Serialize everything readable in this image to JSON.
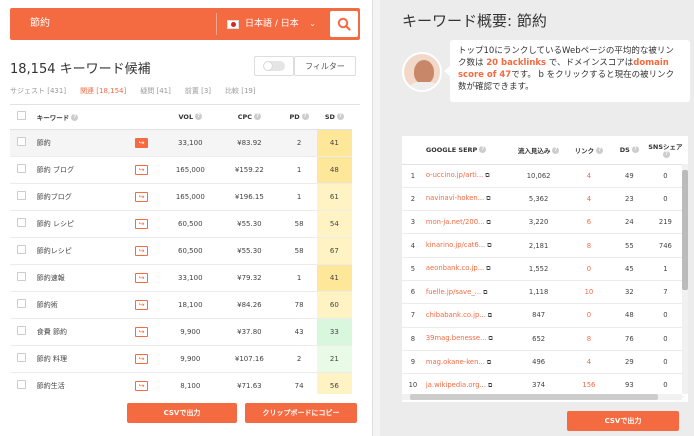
{
  "search": {
    "query": "節約",
    "language": "日本語 / 日本"
  },
  "left": {
    "count_title": "18,154 キーワード候補",
    "filter_label": "フィルター",
    "tabs": [
      {
        "label": "サジェスト [431]",
        "active": false
      },
      {
        "label": "関連 [18,154]",
        "active": true
      },
      {
        "label": "疑問 [41]",
        "active": false
      },
      {
        "label": "前置 [3]",
        "active": false
      },
      {
        "label": "比較 [19]",
        "active": false
      }
    ],
    "columns": {
      "keyword": "キーワード",
      "vol": "VOL",
      "cpc": "CPC",
      "pd": "PD",
      "sd": "SD"
    },
    "rows": [
      {
        "keyword": "節約",
        "vol": "33,100",
        "cpc": "¥83.92",
        "pd": "2",
        "sd": "41",
        "selected": true
      },
      {
        "keyword": "節約 ブログ",
        "vol": "165,000",
        "cpc": "¥159.22",
        "pd": "1",
        "sd": "48",
        "selected": false
      },
      {
        "keyword": "節約ブログ",
        "vol": "165,000",
        "cpc": "¥196.15",
        "pd": "1",
        "sd": "61",
        "selected": false
      },
      {
        "keyword": "節約 レシピ",
        "vol": "60,500",
        "cpc": "¥55.30",
        "pd": "58",
        "sd": "54",
        "selected": false
      },
      {
        "keyword": "節約レシピ",
        "vol": "60,500",
        "cpc": "¥55.30",
        "pd": "58",
        "sd": "67",
        "selected": false
      },
      {
        "keyword": "節約速報",
        "vol": "33,100",
        "cpc": "¥79.32",
        "pd": "1",
        "sd": "41",
        "selected": false
      },
      {
        "keyword": "節約術",
        "vol": "18,100",
        "cpc": "¥84.26",
        "pd": "78",
        "sd": "60",
        "selected": false
      },
      {
        "keyword": "食費 節約",
        "vol": "9,900",
        "cpc": "¥37.80",
        "pd": "43",
        "sd": "33",
        "selected": false
      },
      {
        "keyword": "節約 料理",
        "vol": "9,900",
        "cpc": "¥107.16",
        "pd": "2",
        "sd": "21",
        "selected": false
      },
      {
        "keyword": "節約生活",
        "vol": "8,100",
        "cpc": "¥71.63",
        "pd": "74",
        "sd": "56",
        "selected": false
      }
    ],
    "btn_csv": "CSVで出力",
    "btn_copy": "クリップボードにコピー"
  },
  "right": {
    "title": "キーワード概要: 節約",
    "bubble": {
      "p1": "トップ10にランクしているWebページの平均的な被リンク数は ",
      "backlinks": "20 backlinks",
      "p2": " で、ドメインスコアは",
      "domain_score": "domain score of 47",
      "p3": "です。 b をクリックすると現在の被リンク数が確認できます。"
    },
    "serp_columns": {
      "serp": "GOOGLE SERP",
      "inflow": "流入見込み",
      "links": "リンク",
      "ds": "DS",
      "sns": "SNSシェア"
    },
    "serp_rows": [
      {
        "no": "1",
        "url": "o-uccino.jp/arti...",
        "inflow": "10,062",
        "links": "4",
        "ds": "49",
        "sns": "0"
      },
      {
        "no": "2",
        "url": "navinavi-hoken...",
        "inflow": "5,362",
        "links": "4",
        "ds": "23",
        "sns": "0"
      },
      {
        "no": "3",
        "url": "mon-ja.net/200...",
        "inflow": "3,220",
        "links": "6",
        "ds": "24",
        "sns": "219"
      },
      {
        "no": "4",
        "url": "kinarino.jp/cat6...",
        "inflow": "2,181",
        "links": "8",
        "ds": "55",
        "sns": "746"
      },
      {
        "no": "5",
        "url": "aeonbank.co.jp...",
        "inflow": "1,552",
        "links": "0",
        "ds": "45",
        "sns": "1"
      },
      {
        "no": "6",
        "url": "fuelle.jp/save_...",
        "inflow": "1,118",
        "links": "10",
        "ds": "32",
        "sns": "7"
      },
      {
        "no": "7",
        "url": "chibabank.co.jp...",
        "inflow": "847",
        "links": "0",
        "ds": "48",
        "sns": "0"
      },
      {
        "no": "8",
        "url": "39mag.benesse...",
        "inflow": "652",
        "links": "8",
        "ds": "76",
        "sns": "0"
      },
      {
        "no": "9",
        "url": "mag.okane-ken...",
        "inflow": "496",
        "links": "4",
        "ds": "29",
        "sns": "0"
      },
      {
        "no": "10",
        "url": "ja.wikipedia.org...",
        "inflow": "374",
        "links": "156",
        "ds": "93",
        "sns": "0"
      }
    ],
    "btn_csv": "CSVで出力"
  },
  "colors": {
    "accent": "#f46a41",
    "sd_high": "#ffe79a",
    "sd_mid": "#fff3c4",
    "sd_low": "#d9f7dc",
    "sd_vlow": "#e9fbe6"
  }
}
